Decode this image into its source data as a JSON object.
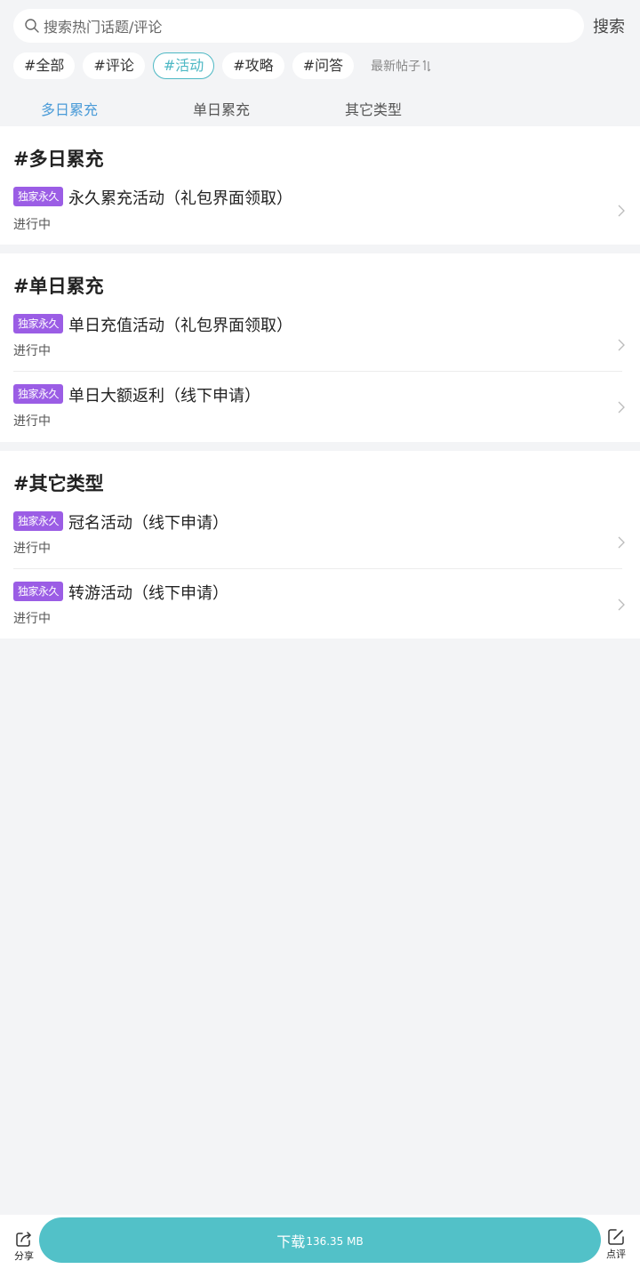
{
  "search": {
    "placeholder": "搜索热门话题/评论",
    "button_label": "搜索"
  },
  "tags": [
    {
      "label": "#全部",
      "active": false
    },
    {
      "label": "#评论",
      "active": false
    },
    {
      "label": "#活动",
      "active": true
    },
    {
      "label": "#攻略",
      "active": false
    },
    {
      "label": "#问答",
      "active": false
    }
  ],
  "sort_label": "最新帖子",
  "subtabs": [
    {
      "label": "多日累充",
      "active": true
    },
    {
      "label": "单日累充",
      "active": false
    },
    {
      "label": "其它类型",
      "active": false
    }
  ],
  "sections": [
    {
      "title": "#多日累充",
      "items": [
        {
          "badge": "独家永久",
          "title": "永久累充活动（礼包界面领取）",
          "status": "进行中"
        }
      ]
    },
    {
      "title": "#单日累充",
      "items": [
        {
          "badge": "独家永久",
          "title": "单日充值活动（礼包界面领取）",
          "status": "进行中"
        },
        {
          "badge": "独家永久",
          "title": "单日大额返利（线下申请）",
          "status": "进行中"
        }
      ]
    },
    {
      "title": "#其它类型",
      "items": [
        {
          "badge": "独家永久",
          "title": "冠名活动（线下申请）",
          "status": "进行中"
        },
        {
          "badge": "独家永久",
          "title": "转游活动（线下申请）",
          "status": "进行中"
        }
      ]
    }
  ],
  "bottom_bar": {
    "share_label": "分享",
    "download_label": "下载",
    "download_size": "136.35 MB",
    "comment_label": "点评"
  },
  "colors": {
    "accent": "#52c1c8",
    "tag_active": "#4db8c4",
    "subtab_active": "#4a9bd8",
    "badge": "#9b5de5",
    "background": "#f3f4f6"
  },
  "icons": {
    "search": "search-icon",
    "sort": "sort-arrows-icon",
    "chevron": "chevron-right-icon",
    "share": "share-icon",
    "comment": "edit-icon"
  }
}
